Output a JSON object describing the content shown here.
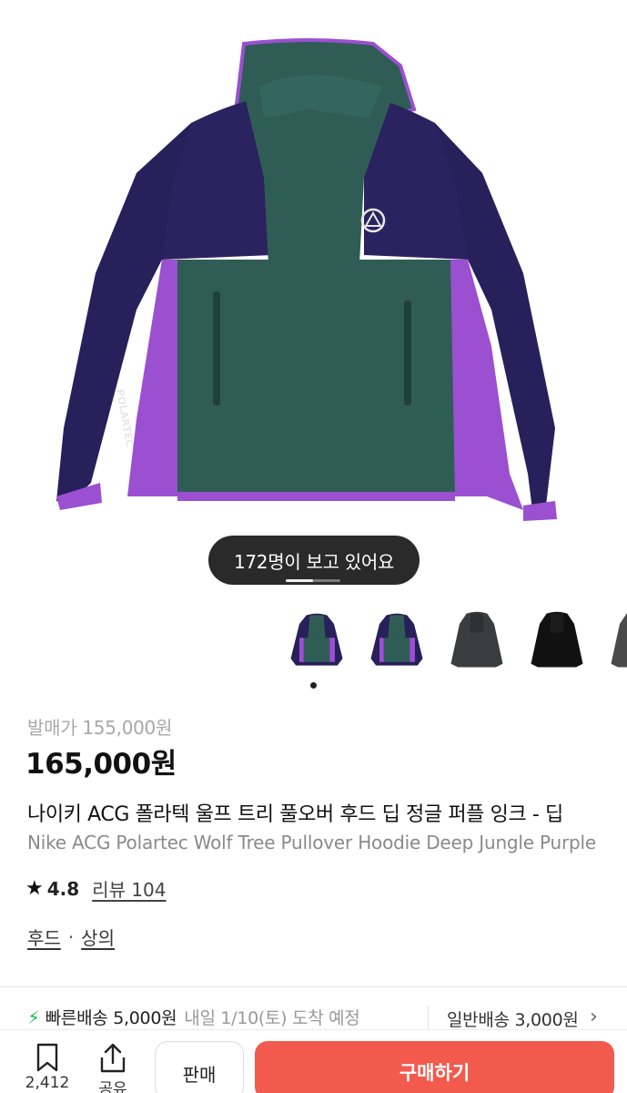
{
  "hero": {
    "viewers_text": "172명이 보고 있어요",
    "image_progress": 0.5
  },
  "thumbnails": [
    {
      "name": "hoodie-purple-green-front"
    },
    {
      "name": "hoodie-purple-green-front-alt"
    },
    {
      "name": "hoodie-charcoal"
    },
    {
      "name": "hoodie-black"
    },
    {
      "name": "hoodie-grey-partial"
    }
  ],
  "product": {
    "msrp": "발매가 155,000원",
    "price": "165,000원",
    "title_ko": "나이키 ACG 폴라텍 울프 트리 풀오버 후드 딥 정글 퍼플 잉크 - 딥",
    "title_en": "Nike ACG Polartec Wolf Tree Pullover Hoodie Deep Jungle Purple",
    "rating": "4.8",
    "review_label": "리뷰 104",
    "category_1": "후드",
    "category_sep": "·",
    "category_2": "상의"
  },
  "shipping": {
    "fast_label": "빠른배송 5,000원",
    "fast_date": "내일 1/10(토) 도착 예정",
    "normal_label": "일반배송 3,000원"
  },
  "bottom_bar": {
    "bookmark_count": "2,412",
    "share_label": "공유",
    "sell_label": "판매",
    "buy_label": "구매하기"
  },
  "colors": {
    "buy_button": "#f25a4e",
    "fast_ship_icon": "#20c05c",
    "hoodie_navy": "#27205a",
    "hoodie_green": "#2f5d56",
    "hoodie_purple": "#9b4fd1"
  }
}
